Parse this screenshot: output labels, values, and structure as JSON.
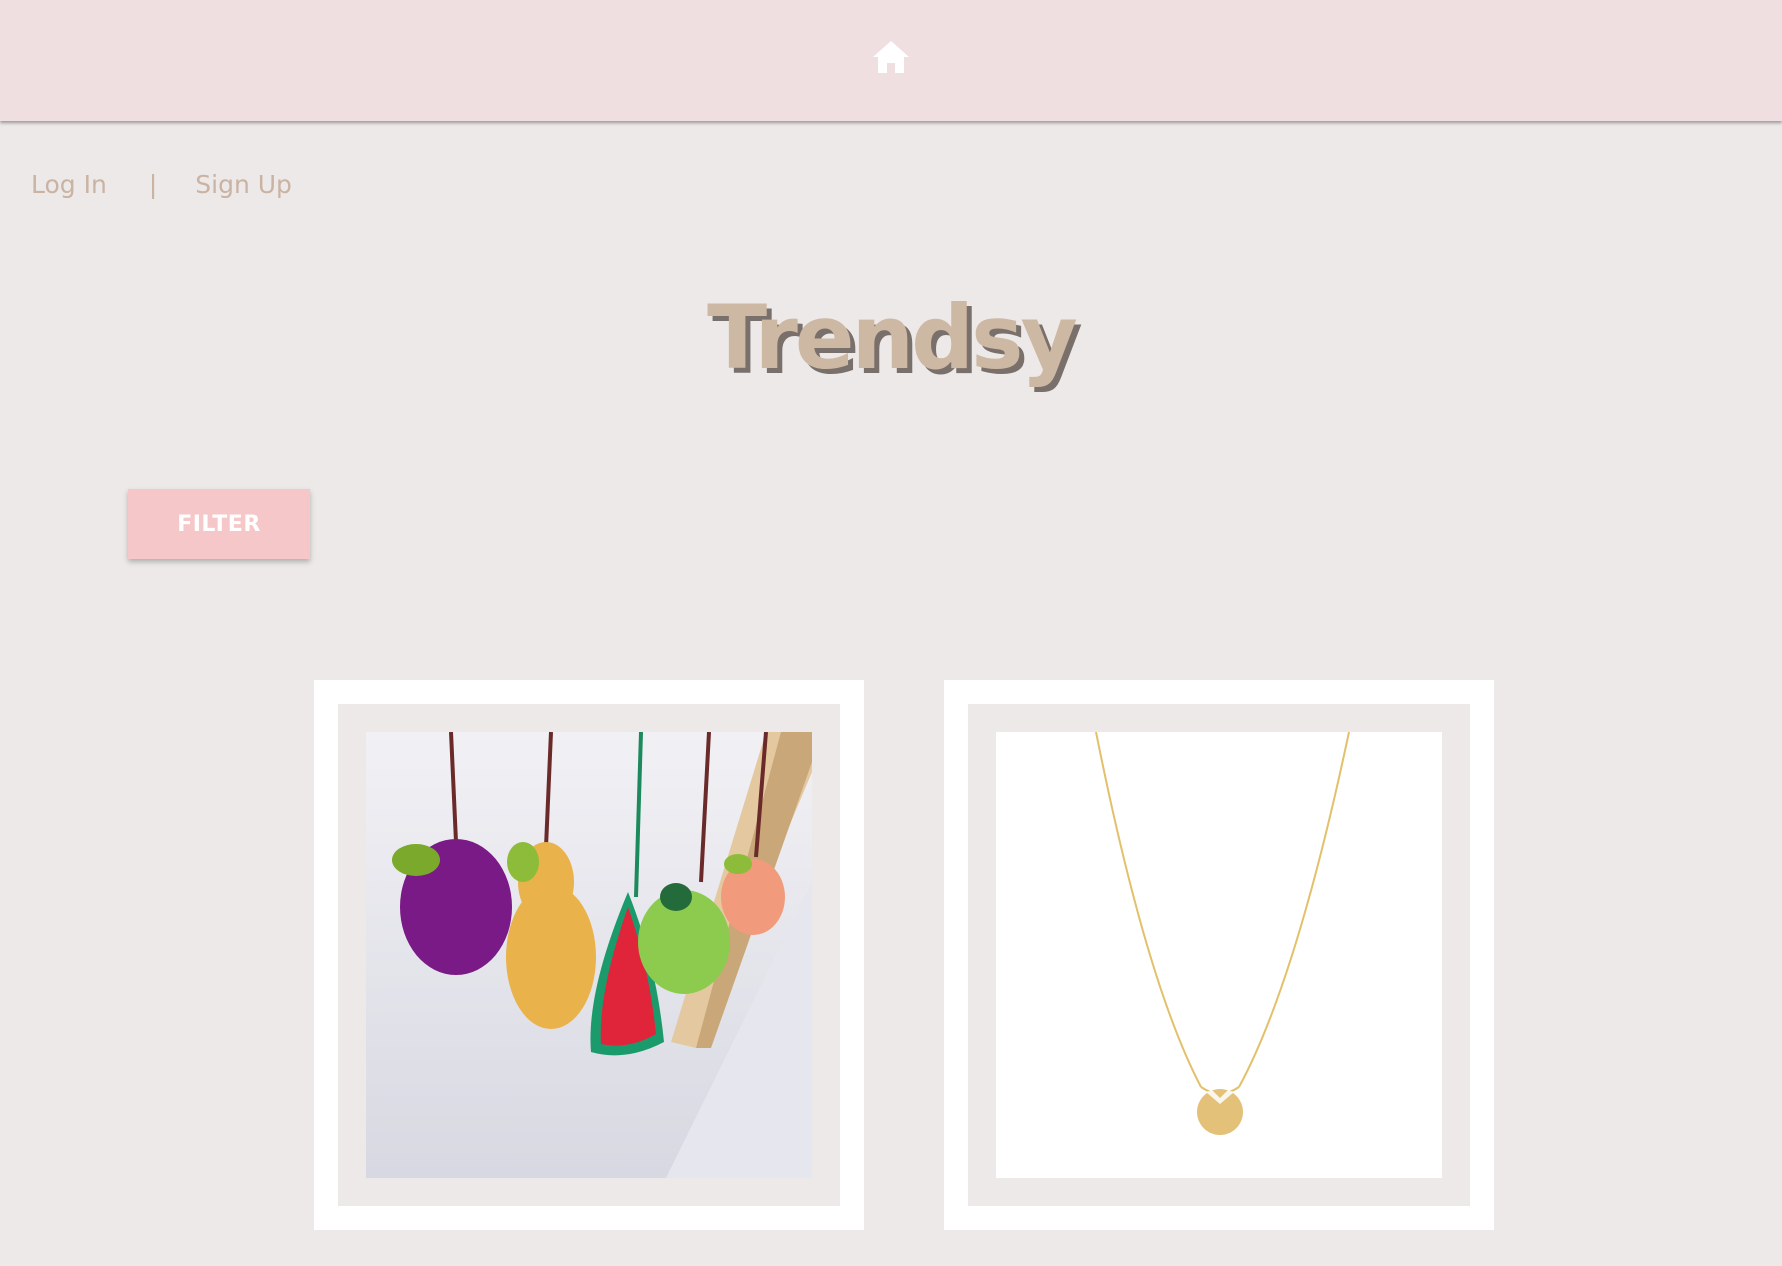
{
  "header": {
    "home_icon": "home-icon",
    "background": "#f0dfe1"
  },
  "auth": {
    "login_label": "Log In",
    "separator": "|",
    "signup_label": "Sign Up"
  },
  "brand": {
    "title": "Trendsy"
  },
  "filter": {
    "label": "FILTER"
  },
  "products": [
    {
      "image": "crocheted-fruit-mobile"
    },
    {
      "image": "gold-pendant-necklace"
    }
  ],
  "colors": {
    "page_bg": "#ede9e9",
    "accent_text": "#c9b3a2",
    "filter_bg": "#f6c7c9"
  }
}
